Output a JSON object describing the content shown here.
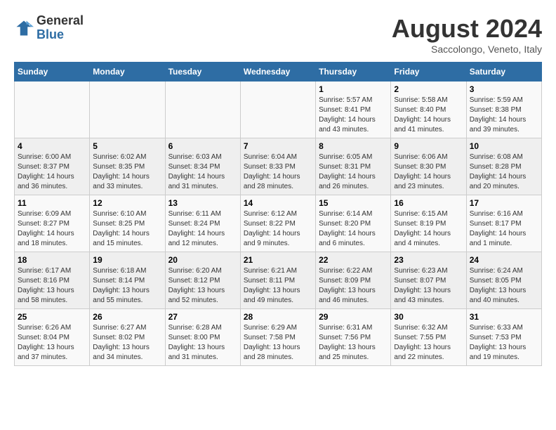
{
  "header": {
    "logo_general": "General",
    "logo_blue": "Blue",
    "month_title": "August 2024",
    "subtitle": "Saccolongo, Veneto, Italy"
  },
  "days_of_week": [
    "Sunday",
    "Monday",
    "Tuesday",
    "Wednesday",
    "Thursday",
    "Friday",
    "Saturday"
  ],
  "weeks": [
    [
      {
        "day": "",
        "info": ""
      },
      {
        "day": "",
        "info": ""
      },
      {
        "day": "",
        "info": ""
      },
      {
        "day": "",
        "info": ""
      },
      {
        "day": "1",
        "info": "Sunrise: 5:57 AM\nSunset: 8:41 PM\nDaylight: 14 hours and 43 minutes."
      },
      {
        "day": "2",
        "info": "Sunrise: 5:58 AM\nSunset: 8:40 PM\nDaylight: 14 hours and 41 minutes."
      },
      {
        "day": "3",
        "info": "Sunrise: 5:59 AM\nSunset: 8:38 PM\nDaylight: 14 hours and 39 minutes."
      }
    ],
    [
      {
        "day": "4",
        "info": "Sunrise: 6:00 AM\nSunset: 8:37 PM\nDaylight: 14 hours and 36 minutes."
      },
      {
        "day": "5",
        "info": "Sunrise: 6:02 AM\nSunset: 8:35 PM\nDaylight: 14 hours and 33 minutes."
      },
      {
        "day": "6",
        "info": "Sunrise: 6:03 AM\nSunset: 8:34 PM\nDaylight: 14 hours and 31 minutes."
      },
      {
        "day": "7",
        "info": "Sunrise: 6:04 AM\nSunset: 8:33 PM\nDaylight: 14 hours and 28 minutes."
      },
      {
        "day": "8",
        "info": "Sunrise: 6:05 AM\nSunset: 8:31 PM\nDaylight: 14 hours and 26 minutes."
      },
      {
        "day": "9",
        "info": "Sunrise: 6:06 AM\nSunset: 8:30 PM\nDaylight: 14 hours and 23 minutes."
      },
      {
        "day": "10",
        "info": "Sunrise: 6:08 AM\nSunset: 8:28 PM\nDaylight: 14 hours and 20 minutes."
      }
    ],
    [
      {
        "day": "11",
        "info": "Sunrise: 6:09 AM\nSunset: 8:27 PM\nDaylight: 14 hours and 18 minutes."
      },
      {
        "day": "12",
        "info": "Sunrise: 6:10 AM\nSunset: 8:25 PM\nDaylight: 14 hours and 15 minutes."
      },
      {
        "day": "13",
        "info": "Sunrise: 6:11 AM\nSunset: 8:24 PM\nDaylight: 14 hours and 12 minutes."
      },
      {
        "day": "14",
        "info": "Sunrise: 6:12 AM\nSunset: 8:22 PM\nDaylight: 14 hours and 9 minutes."
      },
      {
        "day": "15",
        "info": "Sunrise: 6:14 AM\nSunset: 8:20 PM\nDaylight: 14 hours and 6 minutes."
      },
      {
        "day": "16",
        "info": "Sunrise: 6:15 AM\nSunset: 8:19 PM\nDaylight: 14 hours and 4 minutes."
      },
      {
        "day": "17",
        "info": "Sunrise: 6:16 AM\nSunset: 8:17 PM\nDaylight: 14 hours and 1 minute."
      }
    ],
    [
      {
        "day": "18",
        "info": "Sunrise: 6:17 AM\nSunset: 8:16 PM\nDaylight: 13 hours and 58 minutes."
      },
      {
        "day": "19",
        "info": "Sunrise: 6:18 AM\nSunset: 8:14 PM\nDaylight: 13 hours and 55 minutes."
      },
      {
        "day": "20",
        "info": "Sunrise: 6:20 AM\nSunset: 8:12 PM\nDaylight: 13 hours and 52 minutes."
      },
      {
        "day": "21",
        "info": "Sunrise: 6:21 AM\nSunset: 8:11 PM\nDaylight: 13 hours and 49 minutes."
      },
      {
        "day": "22",
        "info": "Sunrise: 6:22 AM\nSunset: 8:09 PM\nDaylight: 13 hours and 46 minutes."
      },
      {
        "day": "23",
        "info": "Sunrise: 6:23 AM\nSunset: 8:07 PM\nDaylight: 13 hours and 43 minutes."
      },
      {
        "day": "24",
        "info": "Sunrise: 6:24 AM\nSunset: 8:05 PM\nDaylight: 13 hours and 40 minutes."
      }
    ],
    [
      {
        "day": "25",
        "info": "Sunrise: 6:26 AM\nSunset: 8:04 PM\nDaylight: 13 hours and 37 minutes."
      },
      {
        "day": "26",
        "info": "Sunrise: 6:27 AM\nSunset: 8:02 PM\nDaylight: 13 hours and 34 minutes."
      },
      {
        "day": "27",
        "info": "Sunrise: 6:28 AM\nSunset: 8:00 PM\nDaylight: 13 hours and 31 minutes."
      },
      {
        "day": "28",
        "info": "Sunrise: 6:29 AM\nSunset: 7:58 PM\nDaylight: 13 hours and 28 minutes."
      },
      {
        "day": "29",
        "info": "Sunrise: 6:31 AM\nSunset: 7:56 PM\nDaylight: 13 hours and 25 minutes."
      },
      {
        "day": "30",
        "info": "Sunrise: 6:32 AM\nSunset: 7:55 PM\nDaylight: 13 hours and 22 minutes."
      },
      {
        "day": "31",
        "info": "Sunrise: 6:33 AM\nSunset: 7:53 PM\nDaylight: 13 hours and 19 minutes."
      }
    ]
  ]
}
